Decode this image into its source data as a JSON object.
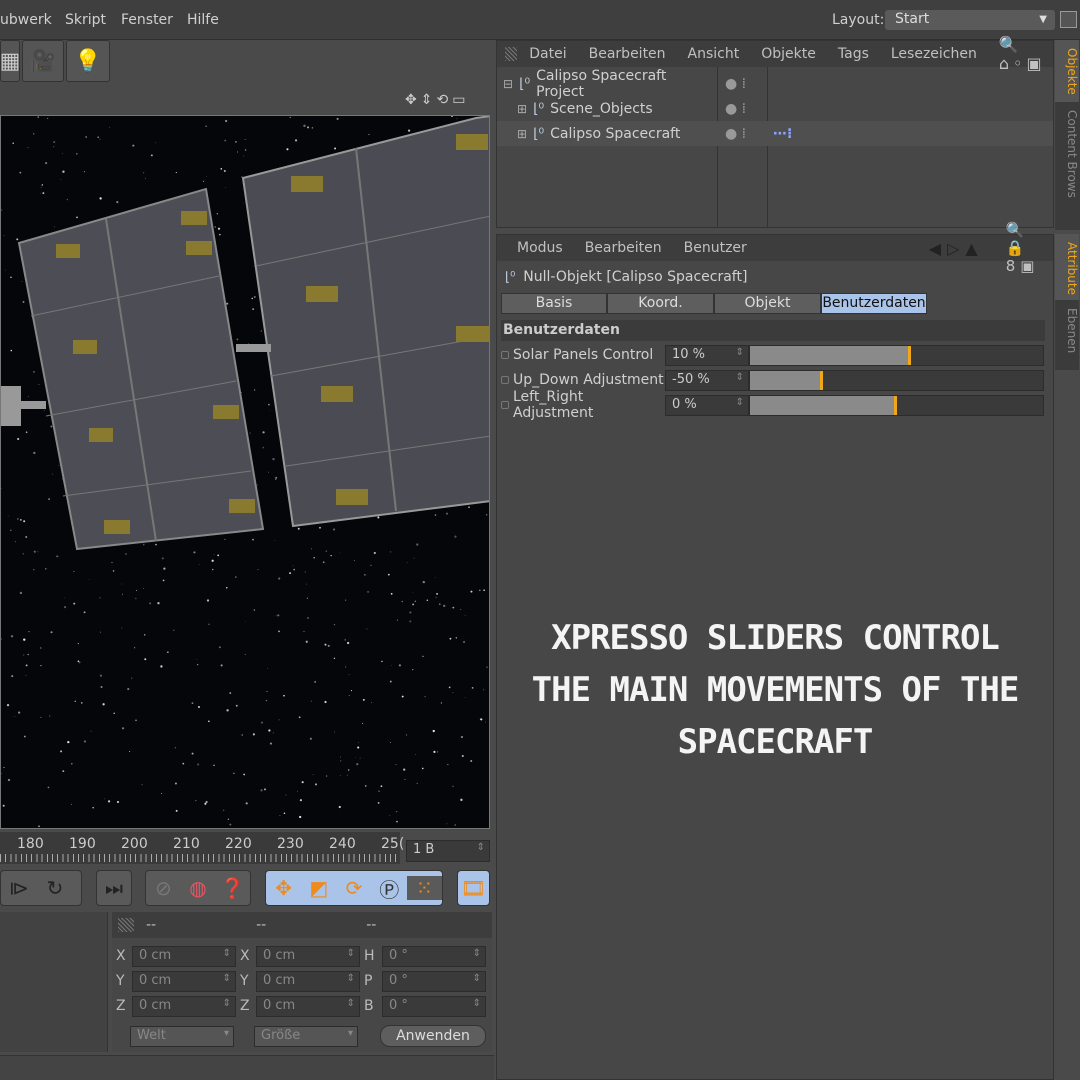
{
  "menu": [
    "ubwerk",
    "Skript",
    "Fenster",
    "Hilfe"
  ],
  "layout": {
    "label": "Layout:",
    "value": "Start"
  },
  "object_manager": {
    "menu": [
      "Datei",
      "Bearbeiten",
      "Ansicht",
      "Objekte",
      "Tags",
      "Lesezeichen"
    ],
    "objects": [
      {
        "name": "Calipso Spacecraft Project",
        "expander": "minus"
      },
      {
        "name": "Scene_Objects",
        "expander": "plus"
      },
      {
        "name": "Calipso Spacecraft",
        "expander": "plus",
        "tag": "xpresso-tag-icon"
      }
    ],
    "side_tabs": [
      "Objekte",
      "Content Brows"
    ]
  },
  "attributes": {
    "menu": [
      "Modus",
      "Bearbeiten",
      "Benutzer"
    ],
    "title": "Null-Objekt [Calipso Spacecraft]",
    "tabs": [
      "Basis",
      "Koord.",
      "Objekt",
      "Benutzerdaten"
    ],
    "active_tab": "Benutzerdaten",
    "section": "Benutzerdaten",
    "side_tabs": [
      "Attribute",
      "Ebenen"
    ],
    "params": [
      {
        "label": "Solar Panels Control",
        "text": "10 %",
        "value": 10
      },
      {
        "label": "Up_Down Adjustment",
        "text": "-50 %",
        "value": -50
      },
      {
        "label": "Left_Right Adjustment",
        "text": "0 %",
        "value": 0
      }
    ],
    "slider_range": [
      -100,
      100
    ],
    "accent": "#f0a818"
  },
  "caption": [
    "XPRESSO SLIDERS CONTROL",
    "THE MAIN MOVEMENTS OF THE",
    "SPACECRAFT"
  ],
  "timeline": {
    "ticks": [
      "180",
      "190",
      "200",
      "210",
      "220",
      "230",
      "240",
      "25("
    ],
    "frame": "1 B"
  },
  "coords": {
    "headers": [
      "--",
      "--",
      "--"
    ],
    "rows": [
      {
        "a": "X",
        "av": "0 cm",
        "b": "X",
        "bv": "0 cm",
        "c": "H",
        "cv": "0 °"
      },
      {
        "a": "Y",
        "av": "0 cm",
        "b": "Y",
        "bv": "0 cm",
        "c": "P",
        "cv": "0 °"
      },
      {
        "a": "Z",
        "av": "0 cm",
        "b": "Z",
        "bv": "0 cm",
        "c": "B",
        "cv": "0 °"
      }
    ],
    "world": "Welt",
    "size": "Größe",
    "apply": "Anwenden"
  }
}
